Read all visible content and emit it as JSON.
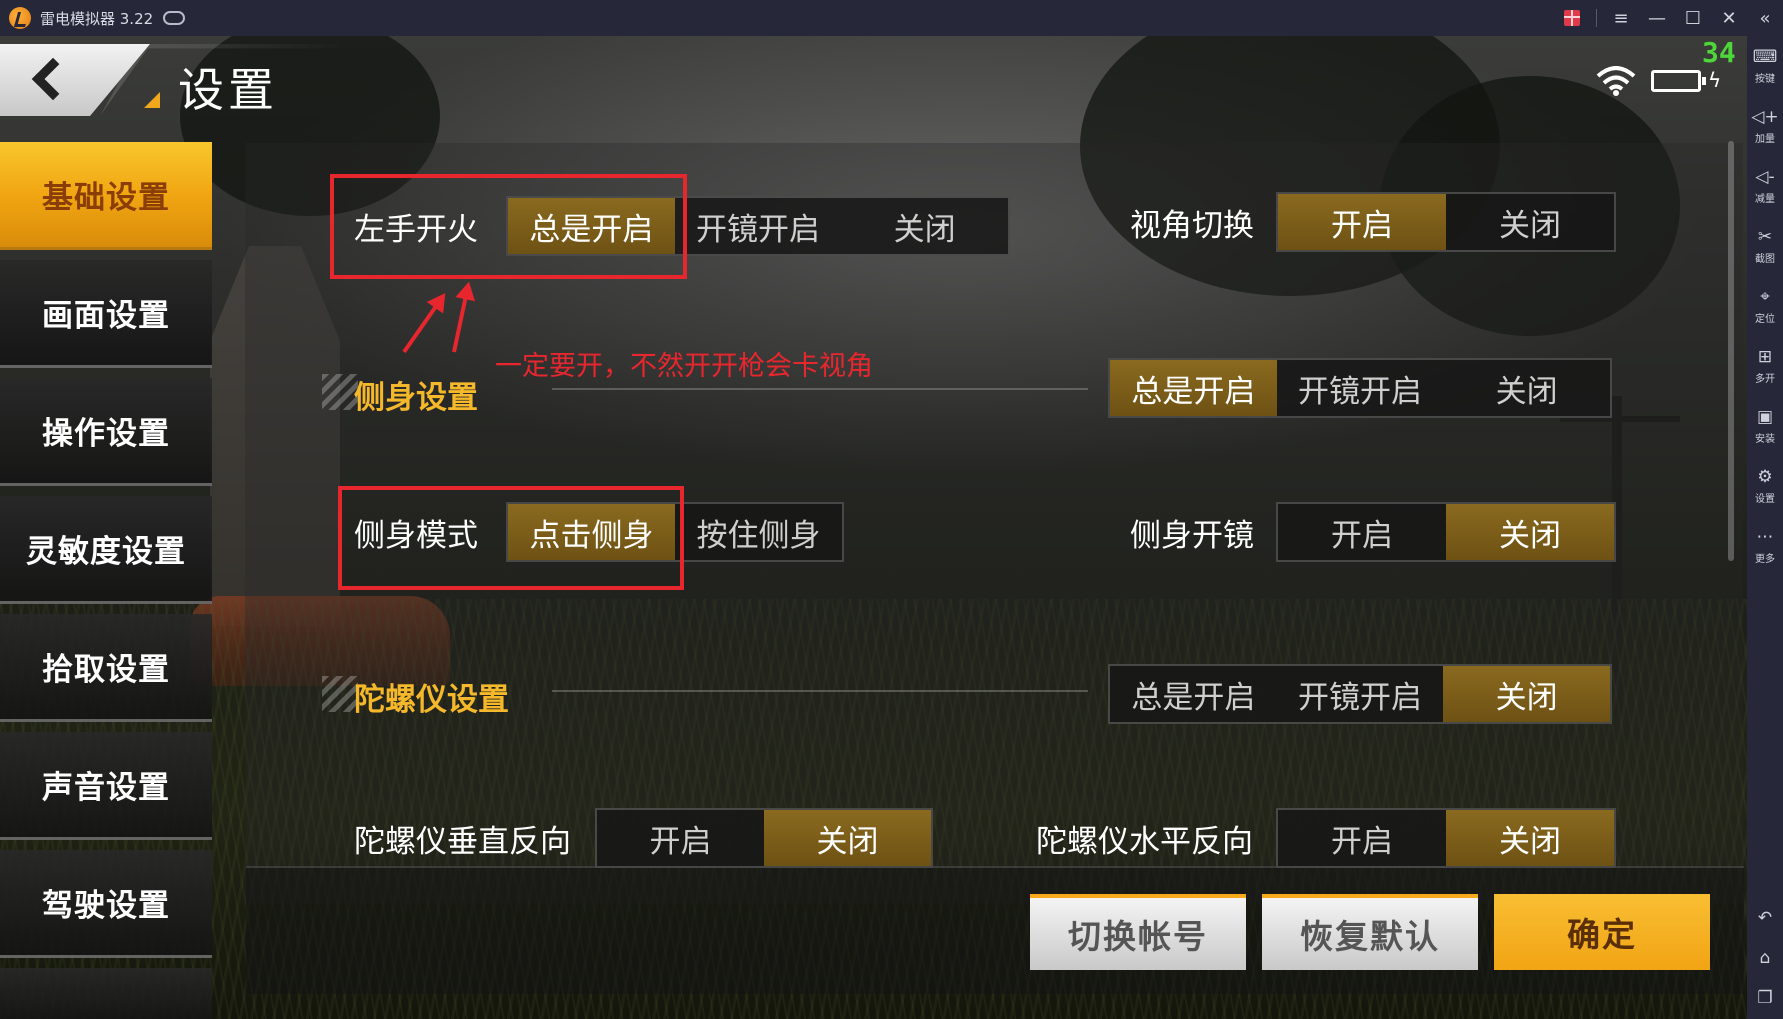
{
  "window": {
    "title": "雷电模拟器 3.22",
    "fps": "34"
  },
  "sidebar_tools": [
    {
      "icon": "keyboard-icon",
      "label": "按键"
    },
    {
      "icon": "volume-up-icon",
      "label": "加量"
    },
    {
      "icon": "volume-down-icon",
      "label": "减量"
    },
    {
      "icon": "scissors-icon",
      "label": "截图"
    },
    {
      "icon": "location-pin-icon",
      "label": "定位"
    },
    {
      "icon": "multi-open-icon",
      "label": "多开"
    },
    {
      "icon": "apk-install-icon",
      "label": "安装"
    },
    {
      "icon": "gear-icon",
      "label": "设置"
    },
    {
      "icon": "more-dots-icon",
      "label": "更多"
    }
  ],
  "page": {
    "title": "设置"
  },
  "nav": [
    {
      "label": "基础设置",
      "active": true
    },
    {
      "label": "画面设置",
      "active": false
    },
    {
      "label": "操作设置",
      "active": false
    },
    {
      "label": "灵敏度设置",
      "active": false
    },
    {
      "label": "拾取设置",
      "active": false
    },
    {
      "label": "声音设置",
      "active": false
    },
    {
      "label": "驾驶设置",
      "active": false
    }
  ],
  "settings": {
    "left_fire": {
      "label": "左手开火",
      "options": [
        "总是开启",
        "开镜开启",
        "关闭"
      ],
      "selected": "总是开启"
    },
    "view_switch": {
      "label": "视角切换",
      "options": [
        "开启",
        "关闭"
      ],
      "selected": "开启"
    },
    "lean_section": {
      "title": "侧身设置",
      "options": [
        "总是开启",
        "开镜开启",
        "关闭"
      ],
      "selected": "总是开启"
    },
    "lean_mode": {
      "label": "侧身模式",
      "options": [
        "点击侧身",
        "按住侧身"
      ],
      "selected": "点击侧身"
    },
    "lean_scope": {
      "label": "侧身开镜",
      "options": [
        "开启",
        "关闭"
      ],
      "selected": "关闭"
    },
    "gyro_section": {
      "title": "陀螺仪设置",
      "options": [
        "总是开启",
        "开镜开启",
        "关闭"
      ],
      "selected": "关闭"
    },
    "gyro_vertical": {
      "label": "陀螺仪垂直反向",
      "options": [
        "开启",
        "关闭"
      ],
      "selected": "关闭"
    },
    "gyro_horizontal": {
      "label": "陀螺仪水平反向",
      "options": [
        "开启",
        "关闭"
      ],
      "selected": "关闭"
    }
  },
  "annotation": {
    "text": "一定要开，不然开开枪会卡视角",
    "color": "#e8262e"
  },
  "buttons": {
    "switch_account": "切换帐号",
    "restore_default": "恢复默认",
    "confirm": "确定"
  },
  "colors": {
    "accent": "#f2a81d",
    "selected_option": "#8a6a1f",
    "section_title": "#f5b82a"
  }
}
